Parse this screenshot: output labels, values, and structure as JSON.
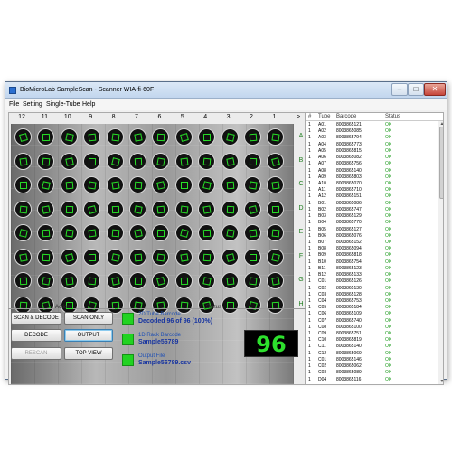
{
  "window": {
    "title": "BioMicroLab SampleScan -  Scanner WIA-fi-60F"
  },
  "menu": [
    "File",
    "Setting",
    "Single-Tube",
    "Help"
  ],
  "plate": {
    "columns": [
      "12",
      "11",
      "10",
      "9",
      "8",
      "7",
      "6",
      "5",
      "4",
      "3",
      "2",
      "1"
    ],
    "rows": [
      "A",
      "B",
      "C",
      "D",
      "E",
      "F",
      "G",
      "H"
    ],
    "nav_arrow": ">"
  },
  "action": {
    "label": "Action",
    "scan_decode": "SCAN & DECODE",
    "scan_only": "SCAN ONLY",
    "decode": "DECODE",
    "output": "OUTPUT",
    "rescan": "RESCAN",
    "top_view": "TOP VIEW"
  },
  "status": {
    "label": "Status",
    "tube_barcode_title": "2D Tube Barcode",
    "tube_barcode_value": "Decoded 96 of 96 (100%)",
    "rack_barcode_title": "1D Rack Barcode",
    "rack_barcode_value": "Sample56789",
    "output_file_title": "Output File",
    "output_file_value": "Sample56789.csv",
    "count": "96",
    "indicator_color": "#21d321"
  },
  "table": {
    "headers": [
      "#",
      "Tube",
      "Barcode",
      "Status"
    ],
    "rows": [
      [
        "1",
        "A01",
        "8003865121",
        "OK"
      ],
      [
        "1",
        "A02",
        "8003865085",
        "OK"
      ],
      [
        "1",
        "A03",
        "8003865794",
        "OK"
      ],
      [
        "1",
        "A04",
        "8003865773",
        "OK"
      ],
      [
        "1",
        "A05",
        "8003865815",
        "OK"
      ],
      [
        "1",
        "A06",
        "8003865082",
        "OK"
      ],
      [
        "1",
        "A07",
        "8003865756",
        "OK"
      ],
      [
        "1",
        "A08",
        "8003865140",
        "OK"
      ],
      [
        "1",
        "A09",
        "8003865803",
        "OK"
      ],
      [
        "1",
        "A10",
        "8003865070",
        "OK"
      ],
      [
        "1",
        "A11",
        "8003865710",
        "OK"
      ],
      [
        "1",
        "A12",
        "8003865151",
        "OK"
      ],
      [
        "1",
        "B01",
        "8003865086",
        "OK"
      ],
      [
        "1",
        "B02",
        "8003865747",
        "OK"
      ],
      [
        "1",
        "B03",
        "8003865129",
        "OK"
      ],
      [
        "1",
        "B04",
        "8003865770",
        "OK"
      ],
      [
        "1",
        "B05",
        "8003865127",
        "OK"
      ],
      [
        "1",
        "B06",
        "8003865076",
        "OK"
      ],
      [
        "1",
        "B07",
        "8003865152",
        "OK"
      ],
      [
        "1",
        "B08",
        "8003865094",
        "OK"
      ],
      [
        "1",
        "B09",
        "8003865818",
        "OK"
      ],
      [
        "1",
        "B10",
        "8003865754",
        "OK"
      ],
      [
        "1",
        "B11",
        "8003865123",
        "OK"
      ],
      [
        "1",
        "B12",
        "8003865133",
        "OK"
      ],
      [
        "1",
        "C01",
        "8003865126",
        "OK"
      ],
      [
        "1",
        "C02",
        "8003865130",
        "OK"
      ],
      [
        "1",
        "C03",
        "8003865128",
        "OK"
      ],
      [
        "1",
        "C04",
        "8003865753",
        "OK"
      ],
      [
        "1",
        "C05",
        "8003865184",
        "OK"
      ],
      [
        "1",
        "C06",
        "8003865109",
        "OK"
      ],
      [
        "1",
        "C07",
        "8003865740",
        "OK"
      ],
      [
        "1",
        "C08",
        "8003865100",
        "OK"
      ],
      [
        "1",
        "C09",
        "8003865751",
        "OK"
      ],
      [
        "1",
        "C10",
        "8003865819",
        "OK"
      ],
      [
        "1",
        "C11",
        "8003865140",
        "OK"
      ],
      [
        "1",
        "C12",
        "8003865069",
        "OK"
      ],
      [
        "1",
        "C01",
        "8003865146",
        "OK"
      ],
      [
        "1",
        "C02",
        "8003865062",
        "OK"
      ],
      [
        "1",
        "C03",
        "8003865089",
        "OK"
      ],
      [
        "1",
        "D04",
        "8003865116",
        "OK"
      ]
    ]
  },
  "colors": {
    "accent_green": "#27e027",
    "ok_green": "#1a9a1a",
    "value_blue": "#1734a0"
  }
}
